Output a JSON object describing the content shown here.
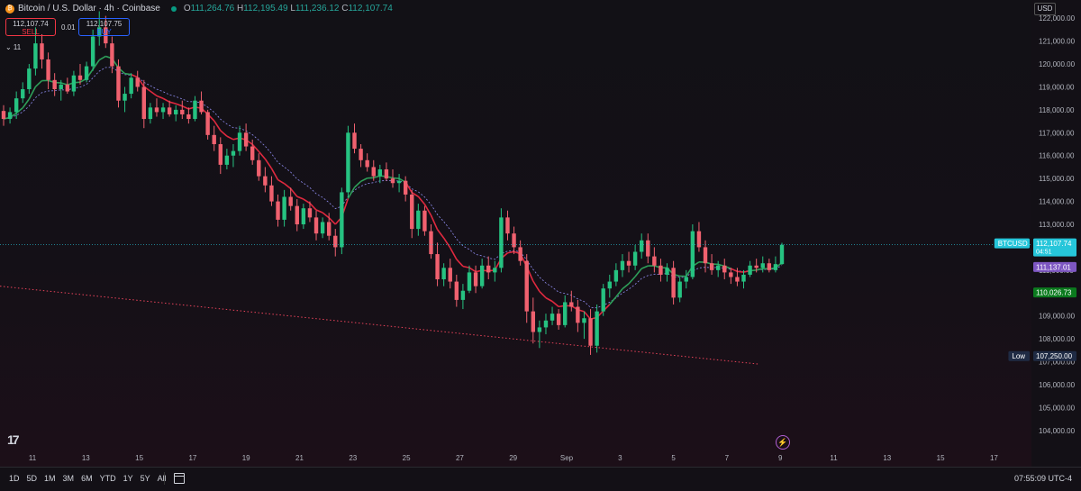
{
  "header": {
    "title": "Bitcoin / U.S. Dollar · 4h · Coinbase",
    "ohlc": [
      {
        "k": "O",
        "v": "111,264.76"
      },
      {
        "k": "H",
        "v": "112,195.49"
      },
      {
        "k": "L",
        "v": "111,236.12"
      },
      {
        "k": "C",
        "v": "112,107.74"
      }
    ]
  },
  "trade": {
    "sell_price": "112,107.74",
    "sell_label": "SELL",
    "buy_price": "112,107.75",
    "buy_label": "BUY",
    "spread": "0.01",
    "collapse": "⌄ 11"
  },
  "currency": "USD",
  "time_ranges": [
    "1D",
    "5D",
    "1M",
    "3M",
    "6M",
    "YTD",
    "1Y",
    "5Y",
    "All"
  ],
  "clock": "07:55:09 UTC-4",
  "icons": [
    "bitcoin-icon",
    "market-status-icon",
    "tradingview-logo-icon",
    "calendar-icon",
    "alert-icon"
  ],
  "chart_data": {
    "type": "candlestick",
    "y_axis_ticks": [
      "122,000.00",
      "121,000.00",
      "120,000.00",
      "119,000.00",
      "118,000.00",
      "117,000.00",
      "116,000.00",
      "115,000.00",
      "114,000.00",
      "113,000.00",
      "112,000.00",
      "111,000.00",
      "110,000.00",
      "109,000.00",
      "108,000.00",
      "107,000.00",
      "106,000.00",
      "105,000.00",
      "104,000.00"
    ],
    "x_axis_ticks": [
      "11",
      "13",
      "15",
      "17",
      "19",
      "21",
      "23",
      "25",
      "27",
      "29",
      "Sep",
      "3",
      "5",
      "7",
      "9",
      "11",
      "13",
      "15",
      "17"
    ],
    "price_labels": [
      {
        "name": "BTCUSD",
        "value": "112,107.74",
        "sub": "04:51",
        "color": "#26c6da"
      },
      {
        "name": "",
        "value": "111,137.01",
        "sub": "",
        "color": "#7e57c2"
      },
      {
        "name": "",
        "value": "110,026.73",
        "sub": "",
        "color": "#0b7a1e"
      },
      {
        "name": "Low",
        "value": "107,250.00",
        "sub": "",
        "color": "#1f2b44"
      }
    ],
    "candles": [
      [
        117950,
        118200,
        117300,
        117600
      ],
      [
        117600,
        118100,
        117400,
        117900
      ],
      [
        117900,
        118800,
        117600,
        118500
      ],
      [
        118500,
        119200,
        118300,
        118900
      ],
      [
        118900,
        120000,
        118700,
        119800
      ],
      [
        119800,
        121600,
        119500,
        120900
      ],
      [
        120900,
        121300,
        119800,
        120200
      ],
      [
        120200,
        120500,
        118900,
        119300
      ],
      [
        119300,
        119600,
        118600,
        118900
      ],
      [
        118900,
        119300,
        118400,
        119100
      ],
      [
        119100,
        119400,
        118700,
        118800
      ],
      [
        118800,
        119700,
        118600,
        119500
      ],
      [
        119500,
        120000,
        119100,
        119300
      ],
      [
        119300,
        120100,
        119200,
        119900
      ],
      [
        119900,
        121500,
        119700,
        121200
      ],
      [
        121200,
        122300,
        120800,
        121600
      ],
      [
        121600,
        122100,
        120700,
        120900
      ],
      [
        120900,
        121200,
        119600,
        119900
      ],
      [
        119900,
        120200,
        118100,
        118400
      ],
      [
        118400,
        119000,
        117900,
        118700
      ],
      [
        118700,
        119600,
        118500,
        119400
      ],
      [
        119400,
        119700,
        118800,
        119000
      ],
      [
        119000,
        119300,
        117200,
        117600
      ],
      [
        117600,
        118300,
        117400,
        118100
      ],
      [
        118100,
        118500,
        117700,
        117900
      ],
      [
        117900,
        118300,
        117600,
        118100
      ],
      [
        118100,
        118400,
        117700,
        117800
      ],
      [
        117800,
        118200,
        117500,
        118000
      ],
      [
        118000,
        118400,
        117600,
        117800
      ],
      [
        117800,
        118100,
        117400,
        117600
      ],
      [
        117600,
        118600,
        117500,
        118400
      ],
      [
        118400,
        118800,
        117800,
        117900
      ],
      [
        117900,
        118000,
        116700,
        116900
      ],
      [
        116900,
        117300,
        116200,
        116500
      ],
      [
        116500,
        116800,
        115200,
        115600
      ],
      [
        115600,
        116300,
        115400,
        116000
      ],
      [
        116000,
        116500,
        115500,
        116200
      ],
      [
        116200,
        117300,
        116000,
        117000
      ],
      [
        117000,
        117400,
        116200,
        116400
      ],
      [
        116400,
        116700,
        115600,
        115800
      ],
      [
        115800,
        116100,
        114900,
        115100
      ],
      [
        115100,
        115500,
        114400,
        114700
      ],
      [
        114700,
        115100,
        113800,
        114000
      ],
      [
        114000,
        114300,
        112900,
        113200
      ],
      [
        113200,
        114500,
        112900,
        114200
      ],
      [
        114200,
        114600,
        113600,
        113800
      ],
      [
        113800,
        114100,
        112700,
        113000
      ],
      [
        113000,
        113900,
        112800,
        113700
      ],
      [
        113700,
        114000,
        113100,
        113300
      ],
      [
        113300,
        113600,
        112300,
        112600
      ],
      [
        112600,
        113300,
        112400,
        113100
      ],
      [
        113100,
        113500,
        112300,
        112500
      ],
      [
        112500,
        112800,
        111600,
        112000
      ],
      [
        112000,
        114600,
        111700,
        114400
      ],
      [
        114400,
        117300,
        114200,
        117000
      ],
      [
        117000,
        117400,
        116100,
        116300
      ],
      [
        116300,
        116500,
        115500,
        115800
      ],
      [
        115800,
        116100,
        115300,
        115500
      ],
      [
        115500,
        115800,
        114900,
        115100
      ],
      [
        115100,
        115600,
        114800,
        115400
      ],
      [
        115400,
        115700,
        114900,
        115000
      ],
      [
        115000,
        115400,
        114600,
        114800
      ],
      [
        114800,
        115200,
        114400,
        114900
      ],
      [
        114900,
        115100,
        114000,
        114300
      ],
      [
        114300,
        114500,
        112400,
        112800
      ],
      [
        112800,
        113900,
        112500,
        113600
      ],
      [
        113600,
        113800,
        112500,
        112700
      ],
      [
        112700,
        113000,
        111500,
        111700
      ],
      [
        111700,
        112200,
        110300,
        110600
      ],
      [
        110600,
        111300,
        110300,
        111100
      ],
      [
        111100,
        111500,
        110200,
        110500
      ],
      [
        110500,
        110800,
        109400,
        109700
      ],
      [
        109700,
        110400,
        109300,
        110100
      ],
      [
        110100,
        111200,
        110000,
        110900
      ],
      [
        110900,
        111200,
        110000,
        110300
      ],
      [
        110300,
        111500,
        110200,
        111200
      ],
      [
        111200,
        111600,
        110600,
        110900
      ],
      [
        110900,
        111400,
        110500,
        111100
      ],
      [
        111100,
        113700,
        110900,
        113300
      ],
      [
        113300,
        113600,
        112300,
        112600
      ],
      [
        112600,
        112900,
        111700,
        112000
      ],
      [
        112000,
        112300,
        111200,
        111400
      ],
      [
        111400,
        111700,
        108700,
        109200
      ],
      [
        109200,
        109800,
        107800,
        108300
      ],
      [
        108300,
        108800,
        107600,
        108500
      ],
      [
        108500,
        109100,
        108200,
        108800
      ],
      [
        108800,
        109400,
        108600,
        109100
      ],
      [
        109100,
        109300,
        108400,
        108600
      ],
      [
        108600,
        109900,
        108500,
        109600
      ],
      [
        109600,
        110100,
        109200,
        109400
      ],
      [
        109400,
        109700,
        108300,
        108700
      ],
      [
        108700,
        109200,
        108000,
        108900
      ],
      [
        108900,
        109300,
        107300,
        107700
      ],
      [
        107700,
        109500,
        107400,
        109200
      ],
      [
        109200,
        110400,
        109000,
        110200
      ],
      [
        110200,
        110800,
        109800,
        110500
      ],
      [
        110500,
        111300,
        110300,
        111000
      ],
      [
        111000,
        111700,
        110700,
        111400
      ],
      [
        111400,
        111800,
        110900,
        111200
      ],
      [
        111200,
        112100,
        111000,
        111800
      ],
      [
        111800,
        112600,
        111500,
        112300
      ],
      [
        112300,
        112600,
        111300,
        111600
      ],
      [
        111600,
        112000,
        110900,
        111200
      ],
      [
        111200,
        111500,
        110500,
        110800
      ],
      [
        110800,
        111300,
        110500,
        111100
      ],
      [
        111100,
        111400,
        109500,
        109800
      ],
      [
        109800,
        110700,
        109600,
        110500
      ],
      [
        110500,
        111000,
        110200,
        110700
      ],
      [
        110700,
        113000,
        110600,
        112700
      ],
      [
        112700,
        113100,
        111800,
        112000
      ],
      [
        112000,
        112300,
        110900,
        111300
      ],
      [
        111300,
        111700,
        110800,
        111000
      ],
      [
        111000,
        111400,
        110700,
        111200
      ],
      [
        111200,
        111500,
        110600,
        110900
      ],
      [
        110900,
        111100,
        110400,
        110700
      ],
      [
        110700,
        111100,
        110300,
        110500
      ],
      [
        110500,
        111000,
        110200,
        110800
      ],
      [
        110800,
        111400,
        110700,
        111200
      ],
      [
        111200,
        111500,
        110900,
        111100
      ],
      [
        111100,
        111600,
        110900,
        111300
      ],
      [
        111300,
        111500,
        110900,
        111000
      ],
      [
        111000,
        111600,
        110900,
        111264
      ],
      [
        111264,
        112195,
        111236,
        112107
      ]
    ],
    "ylim": [
      103600,
      122400
    ]
  }
}
